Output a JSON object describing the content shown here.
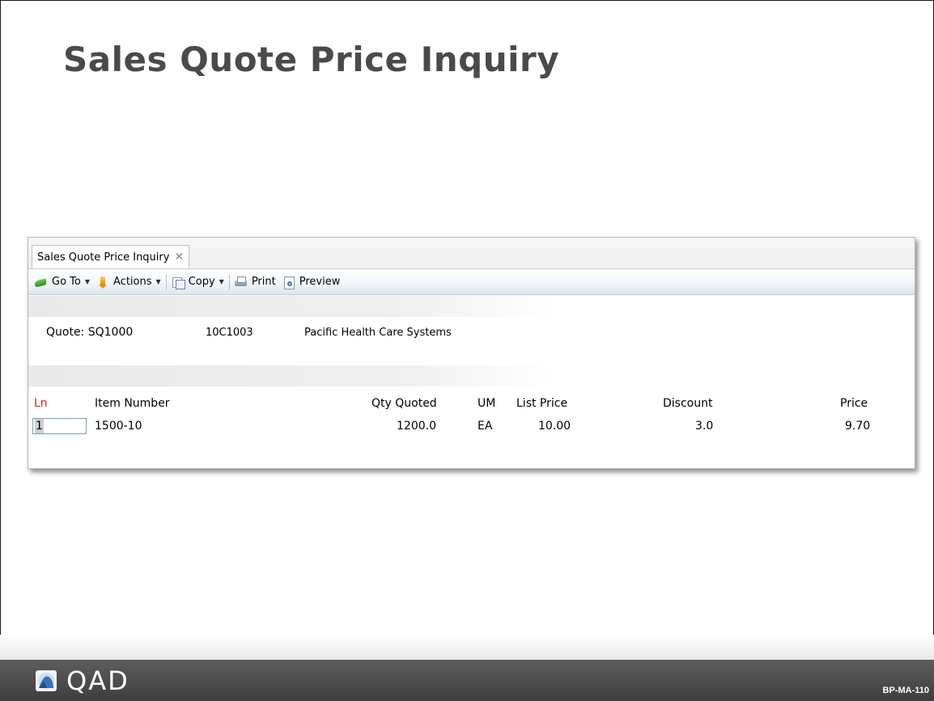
{
  "slide": {
    "title": "Sales Quote Price Inquiry",
    "code": "BP-MA-110",
    "logo_text": "QAD"
  },
  "window": {
    "tab_label": "Sales Quote Price Inquiry",
    "tab_close_icon": "close-icon",
    "toolbar": {
      "goto_label": "Go To",
      "actions_label": "Actions",
      "copy_label": "Copy",
      "print_label": "Print",
      "preview_label": "Preview"
    },
    "quote": {
      "label_value": "Quote: SQ1000",
      "customer": "10C1003",
      "customer_name": "Pacific Health Care Systems"
    },
    "table": {
      "headers": [
        "Ln",
        "Item Number",
        "Qty Quoted",
        "UM",
        "List Price",
        "Discount",
        "Price"
      ],
      "rows": [
        {
          "ln": "1",
          "item": "1500-10",
          "qty": "1200.0",
          "um": "EA",
          "list_price": "10.00",
          "discount": "3.0",
          "price": "9.70"
        }
      ]
    }
  },
  "colors": {
    "title_gray": "#4a4a4a",
    "ln_header_red": "#d32020",
    "footer_dark": "#4a4a4a"
  }
}
